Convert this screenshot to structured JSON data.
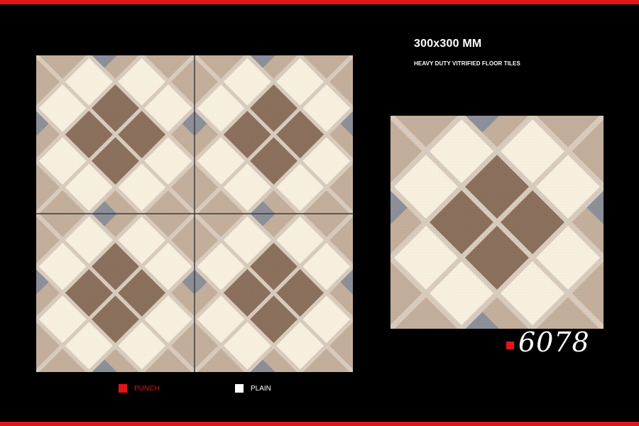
{
  "header": {
    "size": "300x300 MM",
    "description": "HEAVY DUTY VITRIFIED FLOOR TILES"
  },
  "product": {
    "code": "6078"
  },
  "legend": {
    "punch_label": "PUNCH",
    "plain_label": "PLAIN"
  },
  "colors": {
    "accent_red": "#e3151b",
    "cream": "#f7f0df",
    "brown": "#8a705c",
    "tan": "#c2ae9b",
    "grey": "#8c8f98",
    "grout": "#d8cbbd",
    "background": "#000000"
  }
}
